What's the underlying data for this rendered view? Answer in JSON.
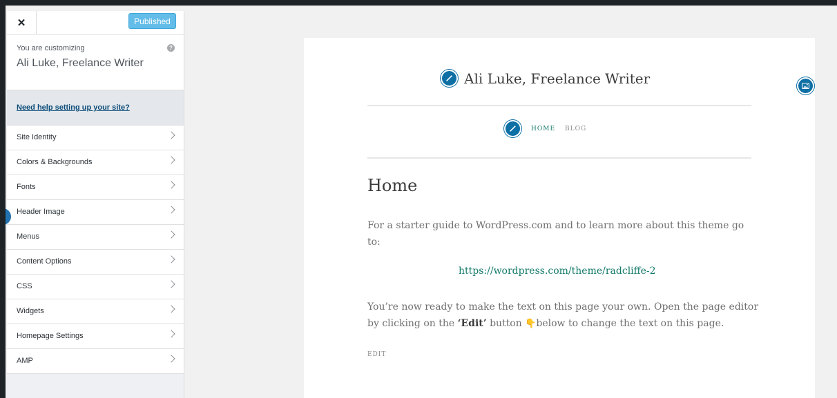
{
  "sidebar": {
    "close_icon": "close-icon",
    "publish_label": "Published",
    "customizing_label": "You are customizing",
    "site_name": "Ali Luke, Freelance Writer",
    "help_icon_glyph": "?",
    "help_link": "Need help setting up your site?",
    "items": [
      {
        "label": "Site Identity"
      },
      {
        "label": "Colors & Backgrounds"
      },
      {
        "label": "Fonts"
      },
      {
        "label": "Header Image"
      },
      {
        "label": "Menus"
      },
      {
        "label": "Content Options"
      },
      {
        "label": "CSS"
      },
      {
        "label": "Widgets"
      },
      {
        "label": "Homepage Settings"
      },
      {
        "label": "AMP"
      }
    ]
  },
  "preview": {
    "site_title": "Ali Luke, Freelance Writer",
    "nav": {
      "home": "HOME",
      "blog": "BLOG"
    },
    "page_heading": "Home",
    "paragraph1": "For a starter guide to WordPress.com and to learn more about this theme go to:",
    "url": "https://wordpress.com/theme/radcliffe-2",
    "paragraph2_before": "You’re now ready to make the text on this page your own. Open the page editor by clicking on the ",
    "paragraph2_bold": "‘Edit’",
    "paragraph2_mid": " button ",
    "paragraph2_emoji": "👇",
    "paragraph2_after": "below to change the text on this page.",
    "edit_link": "EDIT"
  },
  "colors": {
    "accent": "#0e6fa5",
    "publish": "#63bde8",
    "link": "#137a6a"
  }
}
